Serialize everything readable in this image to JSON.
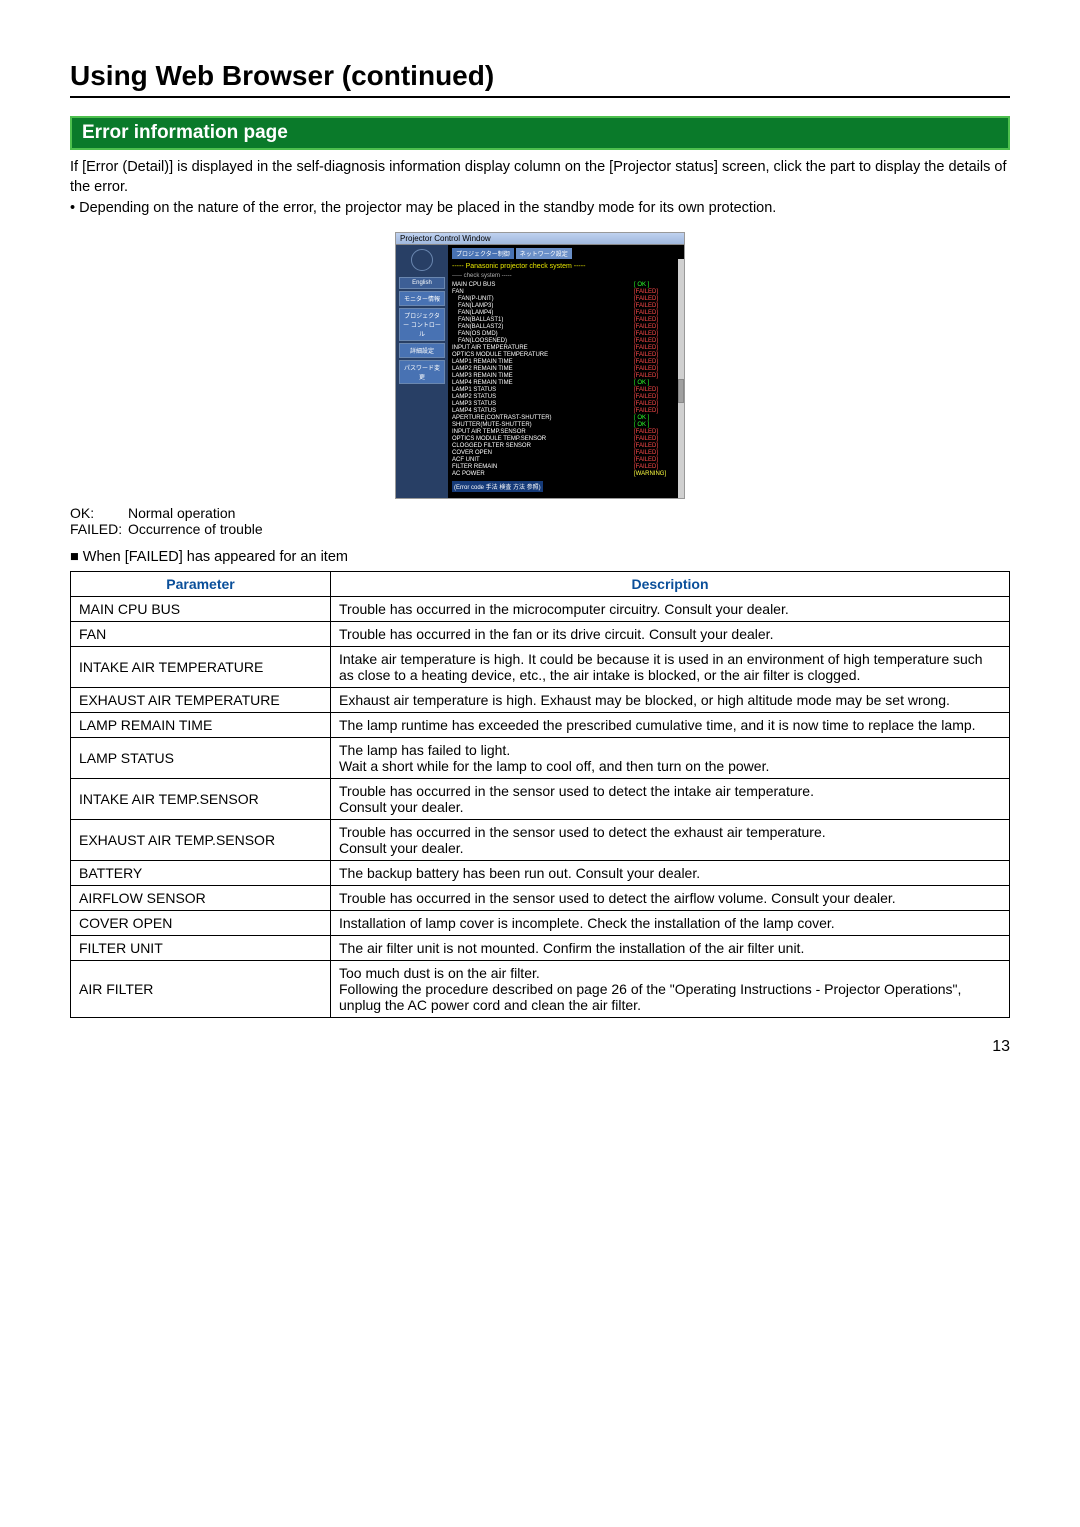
{
  "page": {
    "title": "Using Web Browser (continued)",
    "section_heading": "Error information page",
    "intro": "If [Error (Detail)] is displayed in the self-diagnosis information display column on the [Projector status] screen, click the part to display the details of the error.",
    "note_bullet": "Depending on the nature of the error, the projector may be placed in the standby mode for its own protection.",
    "subhead": "When [FAILED] has appeared for an item",
    "page_number": "13"
  },
  "screenshot": {
    "window_title": "Projector Control Window",
    "tabs": {
      "a": "プロジェクター制御",
      "b": "ネットワーク設定"
    },
    "side": {
      "english": "English",
      "monitor": "モニター情報",
      "control": "プロジェクター コントロール",
      "detail": "詳細設定",
      "password": "パスワード変更"
    },
    "pcs_header": "----- Panasonic projector check system -----",
    "check_system": "----- check system -----",
    "rows": [
      {
        "label": "MAIN CPU BUS",
        "cls": "ok",
        "val": "[ OK ]",
        "indent": false
      },
      {
        "label": "FAN",
        "cls": "failed",
        "val": "[FAILED]",
        "indent": false
      },
      {
        "label": "FAN(P-UNIT)",
        "cls": "failed",
        "val": "[FAILED]",
        "indent": true
      },
      {
        "label": "FAN(LAMP3)",
        "cls": "failed",
        "val": "[FAILED]",
        "indent": true
      },
      {
        "label": "FAN(LAMP4)",
        "cls": "failed",
        "val": "[FAILED]",
        "indent": true
      },
      {
        "label": "FAN(BALLAST1)",
        "cls": "failed",
        "val": "[FAILED]",
        "indent": true
      },
      {
        "label": "FAN(BALLAST2)",
        "cls": "failed",
        "val": "[FAILED]",
        "indent": true
      },
      {
        "label": "FAN(OS DMD)",
        "cls": "failed",
        "val": "[FAILED]",
        "indent": true
      },
      {
        "label": "FAN(LOOSENED)",
        "cls": "failed",
        "val": "[FAILED]",
        "indent": true
      },
      {
        "label": "INPUT AIR TEMPERATURE",
        "cls": "failed",
        "val": "[FAILED]",
        "indent": false
      },
      {
        "label": "OPTICS MODULE TEMPERATURE",
        "cls": "failed",
        "val": "[FAILED]",
        "indent": false
      },
      {
        "label": "LAMP1 REMAIN TIME",
        "cls": "failed",
        "val": "[FAILED]",
        "indent": false
      },
      {
        "label": "LAMP2 REMAIN TIME",
        "cls": "failed",
        "val": "[FAILED]",
        "indent": false
      },
      {
        "label": "LAMP3 REMAIN TIME",
        "cls": "failed",
        "val": "[FAILED]",
        "indent": false
      },
      {
        "label": "LAMP4 REMAIN TIME",
        "cls": "ok",
        "val": "[ OK ]",
        "indent": false
      },
      {
        "label": "LAMP1 STATUS",
        "cls": "failed",
        "val": "[FAILED]",
        "indent": false
      },
      {
        "label": "LAMP2 STATUS",
        "cls": "failed",
        "val": "[FAILED]",
        "indent": false
      },
      {
        "label": "LAMP3 STATUS",
        "cls": "failed",
        "val": "[FAILED]",
        "indent": false
      },
      {
        "label": "LAMP4 STATUS",
        "cls": "failed",
        "val": "[FAILED]",
        "indent": false
      },
      {
        "label": "APERTURE(CONTRAST-SHUTTER)",
        "cls": "ok",
        "val": "[ OK ]",
        "indent": false
      },
      {
        "label": "SHUTTER(MUTE-SHUTTER)",
        "cls": "ok",
        "val": "[ OK ]",
        "indent": false
      },
      {
        "label": "INPUT AIR TEMP.SENSOR",
        "cls": "failed",
        "val": "[FAILED]",
        "indent": false
      },
      {
        "label": "OPTICS MODULE TEMP.SENSOR",
        "cls": "failed",
        "val": "[FAILED]",
        "indent": false
      },
      {
        "label": "CLOGGED FILTER SENSOR",
        "cls": "failed",
        "val": "[FAILED]",
        "indent": false
      },
      {
        "label": "COVER OPEN",
        "cls": "failed",
        "val": "[FAILED]",
        "indent": false
      },
      {
        "label": "ACF UNIT",
        "cls": "failed",
        "val": "[FAILED]",
        "indent": false
      },
      {
        "label": "FILTER REMAIN",
        "cls": "failed",
        "val": "[FAILED]",
        "indent": false
      },
      {
        "label": "AC POWER",
        "cls": "warn",
        "val": "[WARNING]",
        "indent": false
      }
    ],
    "error_code_note": "(Error code 手法 検査 方法 参照)"
  },
  "legend": {
    "ok_key": "OK:",
    "ok_val": "Normal operation",
    "failed_key": "FAILED:",
    "failed_val": "Occurrence of trouble"
  },
  "table": {
    "h1": "Parameter",
    "h2": "Description",
    "rows": [
      {
        "p": "MAIN CPU BUS",
        "d": "Trouble has occurred in the microcomputer circuitry. Consult your dealer."
      },
      {
        "p": "FAN",
        "d": "Trouble has occurred in the fan or its drive circuit. Consult your dealer."
      },
      {
        "p": "INTAKE AIR TEMPERATURE",
        "d": "Intake air temperature is high. It could be because it is used in an environment of high temperature such as close to a heating device, etc., the air intake is blocked, or the air filter is clogged."
      },
      {
        "p": "EXHAUST AIR TEMPERATURE",
        "d": "Exhaust air temperature is high. Exhaust may be blocked, or high altitude mode may be set wrong."
      },
      {
        "p": "LAMP REMAIN TIME",
        "d": "The lamp runtime has exceeded the prescribed cumulative time, and it is now time to replace the lamp."
      },
      {
        "p": "LAMP STATUS",
        "d": "The lamp has failed to light.\nWait a short while for the lamp to cool off, and then turn on the power."
      },
      {
        "p": "INTAKE AIR TEMP.SENSOR",
        "d": "Trouble has occurred in the sensor used to detect the intake air temperature.\nConsult your dealer."
      },
      {
        "p": "EXHAUST AIR TEMP.SENSOR",
        "d": "Trouble has occurred in the sensor used to detect the exhaust air temperature.\nConsult your dealer."
      },
      {
        "p": "BATTERY",
        "d": "The backup battery has been run out. Consult your dealer."
      },
      {
        "p": "AIRFLOW SENSOR",
        "d": "Trouble has occurred in the sensor used to detect the airflow volume. Consult your dealer."
      },
      {
        "p": "COVER OPEN",
        "d": "Installation of lamp cover is incomplete. Check the installation of the lamp cover."
      },
      {
        "p": "FILTER UNIT",
        "d": "The air filter unit is not mounted. Confirm the installation of the air filter unit."
      },
      {
        "p": "AIR FILTER",
        "d": "Too much dust is on the air filter.\nFollowing the procedure described on page 26 of the \"Operating Instructions - Projector Operations\", unplug the AC power cord and clean the air filter."
      }
    ]
  }
}
